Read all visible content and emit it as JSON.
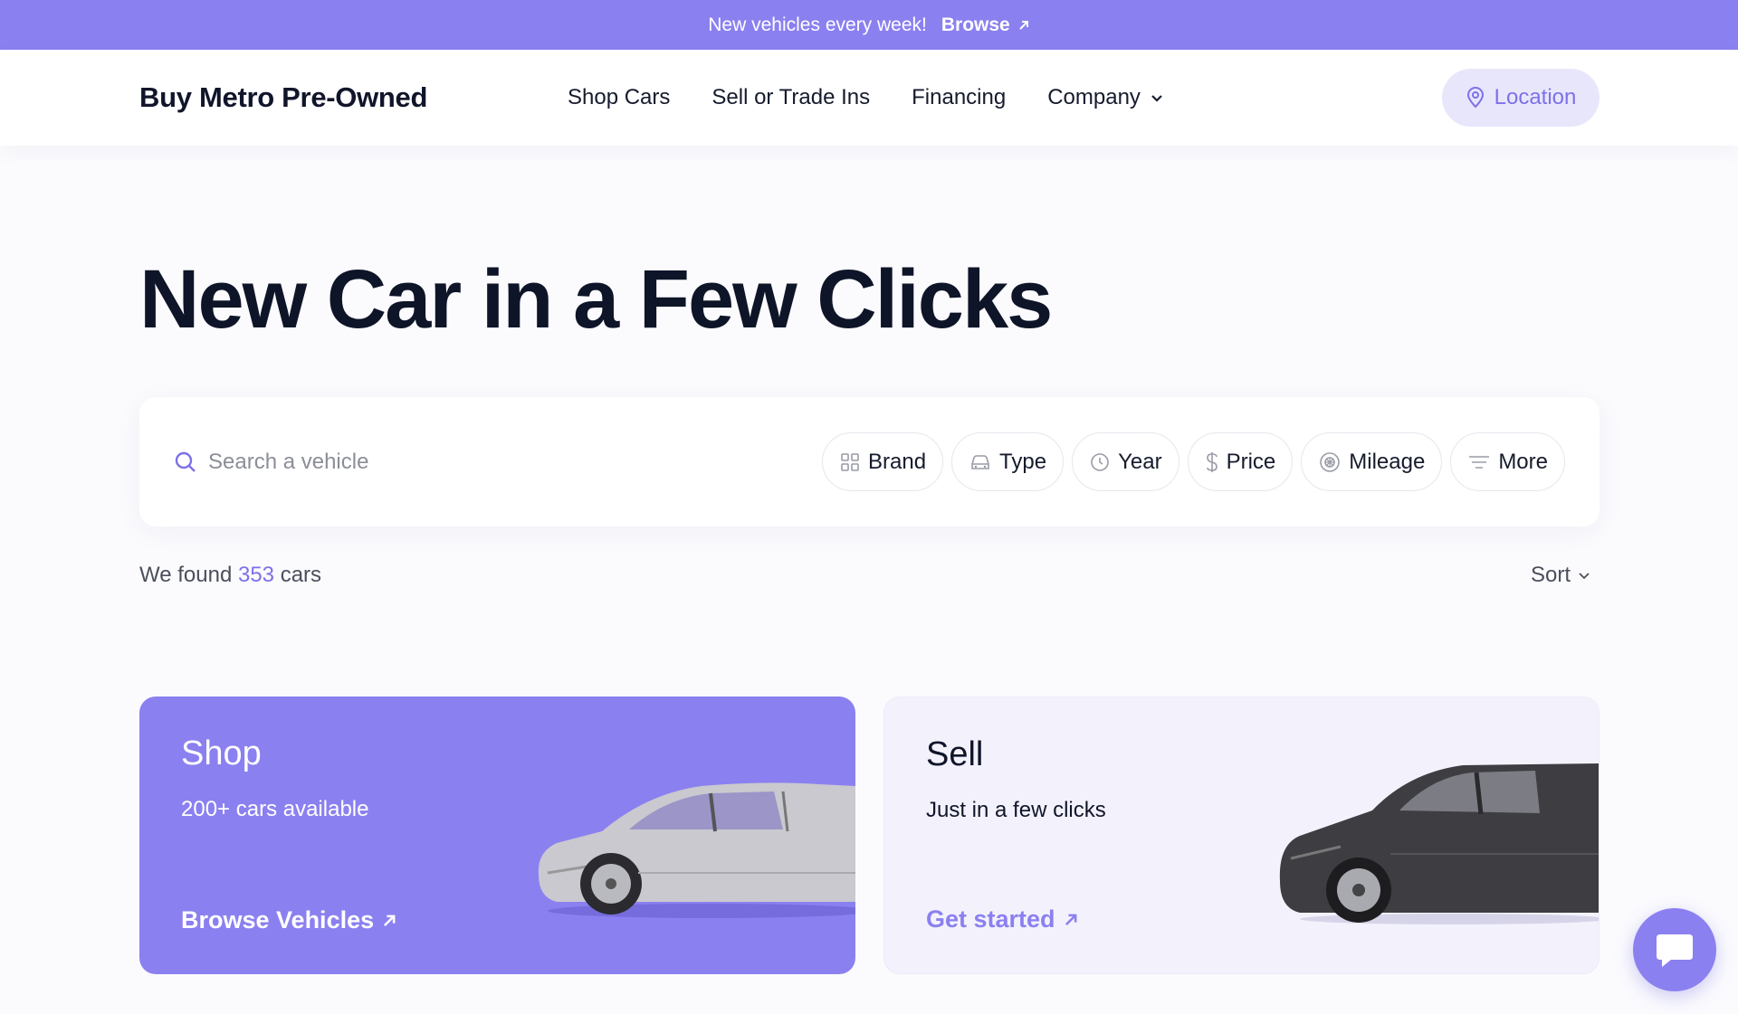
{
  "announcement": {
    "text": "New vehicles every week!",
    "link_label": "Browse"
  },
  "header": {
    "brand": "Buy Metro Pre-Owned",
    "nav": [
      {
        "label": "Shop Cars"
      },
      {
        "label": "Sell or Trade Ins"
      },
      {
        "label": "Financing"
      },
      {
        "label": "Company"
      }
    ],
    "location_label": "Location"
  },
  "hero": {
    "title": "New Car in a Few Clicks"
  },
  "search": {
    "placeholder": "Search a vehicle",
    "filters": [
      {
        "label": "Brand",
        "icon": "grid-icon"
      },
      {
        "label": "Type",
        "icon": "car-icon"
      },
      {
        "label": "Year",
        "icon": "clock-icon"
      },
      {
        "label": "Price",
        "icon": "dollar-icon"
      },
      {
        "label": "Mileage",
        "icon": "wheel-icon"
      },
      {
        "label": "More",
        "icon": "filter-lines-icon"
      }
    ]
  },
  "results": {
    "prefix": "We found",
    "count": "353",
    "suffix": "cars",
    "sort_label": "Sort"
  },
  "cards": {
    "shop": {
      "title": "Shop",
      "subtitle": "200+ cars available",
      "cta": "Browse Vehicles"
    },
    "sell": {
      "title": "Sell",
      "subtitle": "Just in a few clicks",
      "cta": "Get started"
    }
  },
  "colors": {
    "accent": "#8b80f0",
    "accent_light": "#e8e6fb",
    "text_dark": "#0e1528"
  }
}
